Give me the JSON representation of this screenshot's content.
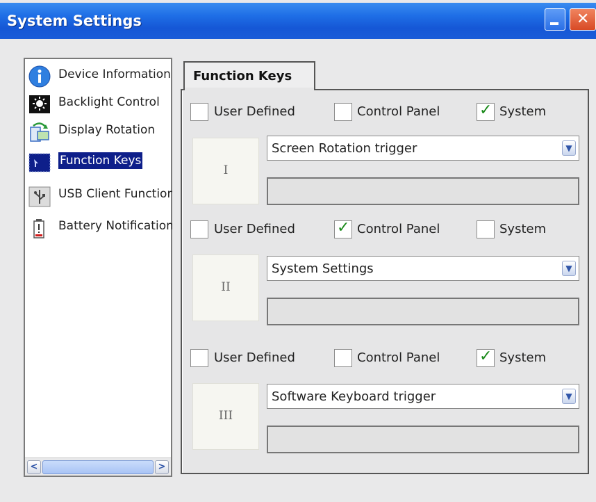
{
  "window": {
    "title": "System Settings"
  },
  "sidebar": {
    "items": [
      {
        "label": "Device Information",
        "icon": "info-icon",
        "selected": false
      },
      {
        "label": "Backlight Control",
        "icon": "backlight-icon",
        "selected": false
      },
      {
        "label": "Display Rotation",
        "icon": "rotation-icon",
        "selected": false
      },
      {
        "label": "Function Keys",
        "icon": "function-keys-icon",
        "selected": true
      },
      {
        "label": "USB Client Function",
        "icon": "usb-icon",
        "selected": false
      },
      {
        "label": "Battery Notification",
        "icon": "battery-icon",
        "selected": false
      }
    ]
  },
  "tab": {
    "label": "Function Keys"
  },
  "groups": [
    {
      "key_label": "I",
      "options": [
        {
          "label": "User Defined",
          "checked": false
        },
        {
          "label": "Control Panel",
          "checked": false
        },
        {
          "label": "System",
          "checked": true
        }
      ],
      "selected_value": "Screen Rotation trigger",
      "text_value": ""
    },
    {
      "key_label": "II",
      "options": [
        {
          "label": "User Defined",
          "checked": false
        },
        {
          "label": "Control Panel",
          "checked": true
        },
        {
          "label": "System",
          "checked": false
        }
      ],
      "selected_value": "System Settings",
      "text_value": ""
    },
    {
      "key_label": "III",
      "options": [
        {
          "label": "User Defined",
          "checked": false
        },
        {
          "label": "Control Panel",
          "checked": false
        },
        {
          "label": "System",
          "checked": true
        }
      ],
      "selected_value": "Software Keyboard trigger",
      "text_value": ""
    }
  ],
  "colors": {
    "titlebar": "#1f6fe6",
    "selection": "#0e1f8a",
    "checkmark": "#1a8a1a"
  }
}
